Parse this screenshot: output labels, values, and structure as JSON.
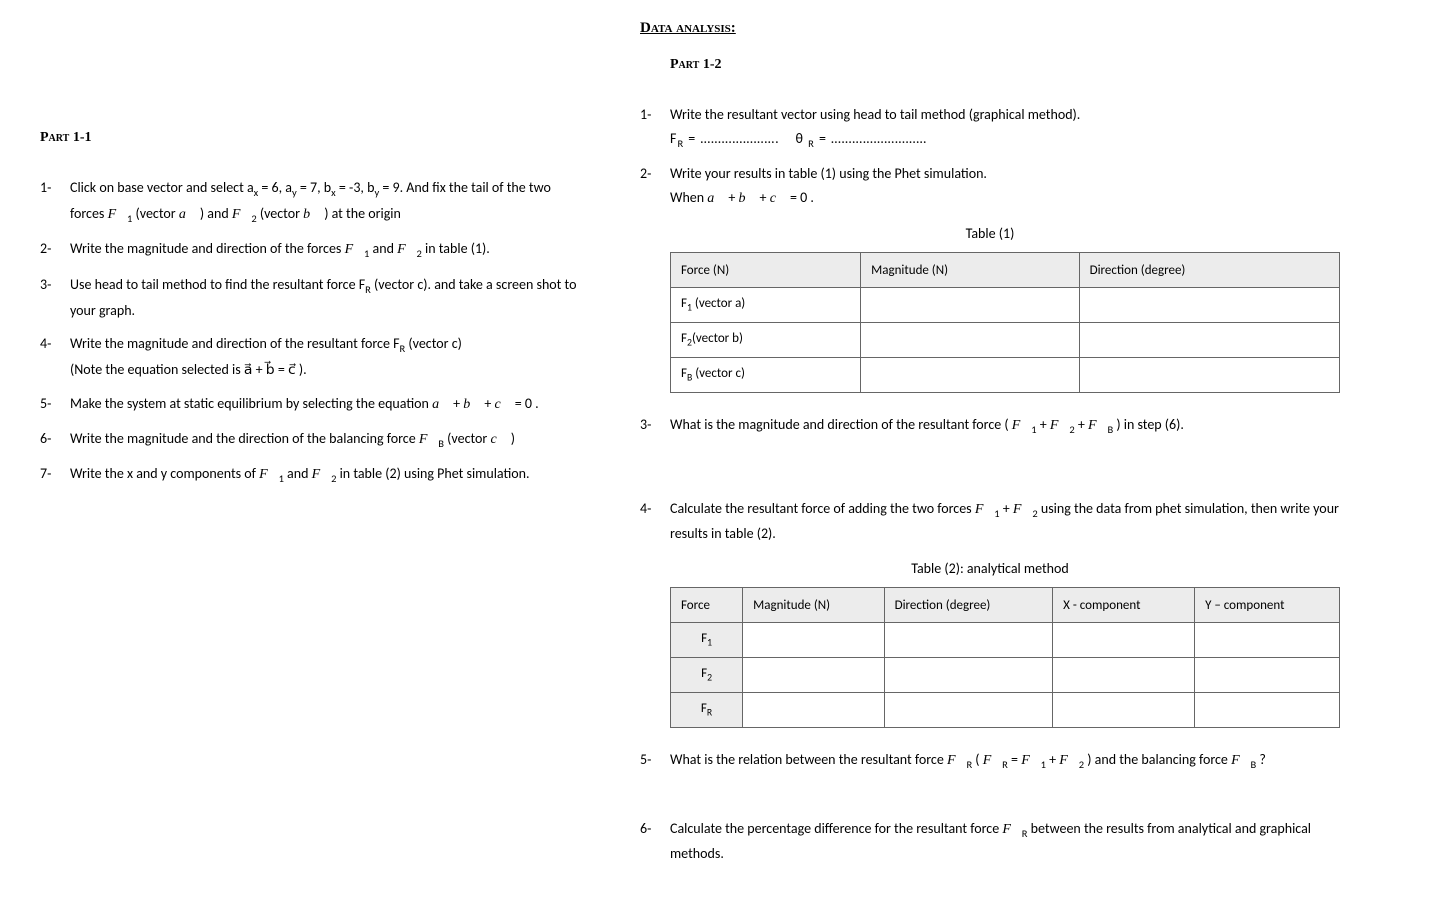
{
  "left": {
    "part_title": "Part 1-1",
    "items": [
      "Click on base vector and select aₓ = 6, a_y = 7, bₓ = -3, b_y = 9. And fix the tail of the two forces F⃗₁ (vector a⃗ ) and F⃗₂ (vector b⃗ ) at the origin",
      "Write the magnitude and direction of the forces F⃗₁ and F⃗₂ in table (1).",
      "Use head to tail method to find the resultant force F_R (vector c). and take a screen shot to your graph.",
      "Write the magnitude and direction of the resultant force F_R (vector c)",
      "Make the system at static equilibrium by selecting the equation a⃗ + b⃗ + c⃗ = 0 .",
      "Write the magnitude and the direction of the balancing force F⃗_B (vector c⃗ )",
      "Write the x and y components of F⃗₁ and F⃗₂ in table (2) using Phet simulation."
    ],
    "item4_note": "(Note the equation selected is a⃗ + b⃗ = c⃗ )."
  },
  "right": {
    "section_title": "Data analysis:",
    "part_title": "Part 1-2",
    "q1": "Write the resultant vector using head to tail method (graphical method).",
    "q1_fill_fr": "F_R = ………………….",
    "q1_fill_theta": "θ _R = ………………………",
    "q2": "Write your results in table (1) using the Phet simulation.",
    "q2_when": "When a⃗ + b⃗ + c⃗ = 0 .",
    "table1_caption": "Table (1)",
    "table1_headers": [
      "Force (N)",
      "Magnitude (N)",
      "Direction (degree)"
    ],
    "table1_rows": [
      "F₁ (vector a)",
      "F₂(vector b)",
      "F_B (vector c)"
    ],
    "q3": "What is the magnitude and direction of the resultant force ( F⃗₁ + F⃗₂ + F⃗_B ) in step (6).",
    "q4": "Calculate the resultant force of adding the two forces F⃗₁ + F⃗₂ using the data from phet simulation, then write your results in table (2).",
    "table2_caption": "Table (2): analytical method",
    "table2_headers": [
      "Force",
      "Magnitude (N)",
      "Direction (degree)",
      "X - component",
      "Y – component"
    ],
    "table2_rows": [
      "F₁",
      "F₂",
      "F_R"
    ],
    "q5": "What is the relation between the resultant force F⃗_R ( F⃗_R = F⃗₁ + F⃗₂ ) and the balancing force F⃗_B ?",
    "q6": "Calculate the percentage difference for the resultant force F⃗_R between the results from analytical and graphical methods."
  }
}
